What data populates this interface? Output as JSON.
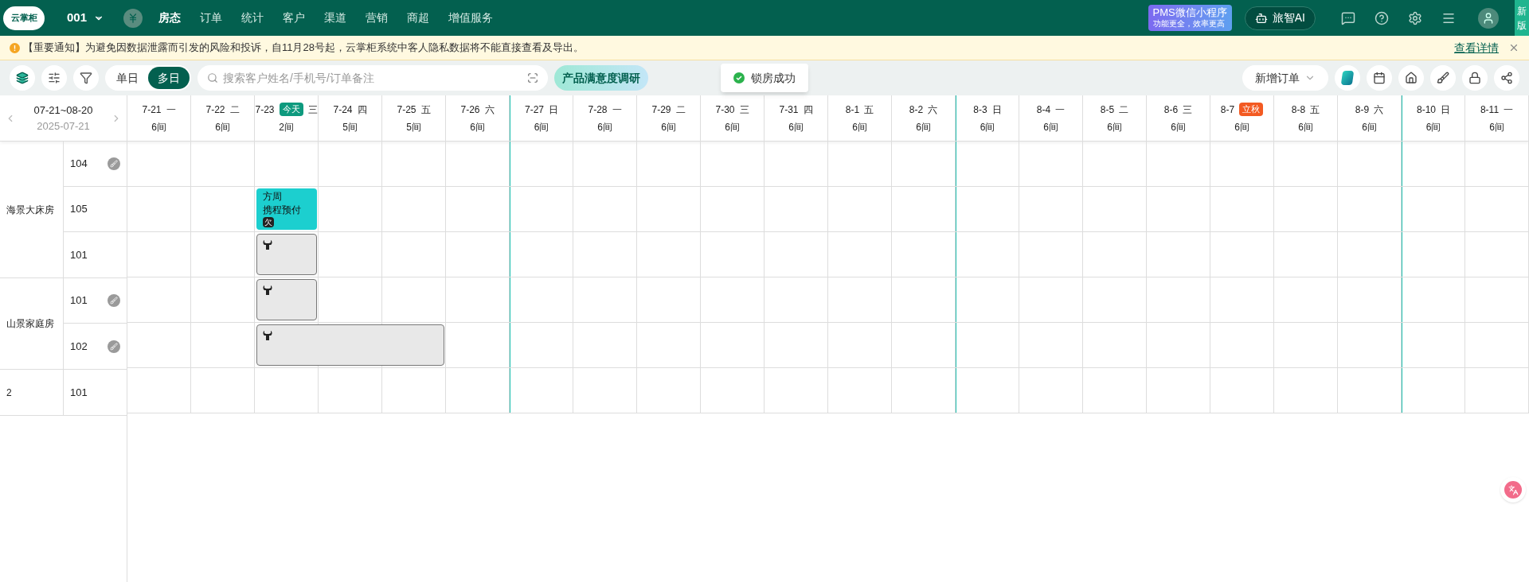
{
  "topbar": {
    "logo": "云掌柜",
    "store": "001",
    "nav": [
      {
        "label": "房态",
        "selected": true
      },
      {
        "label": "订单",
        "selected": false
      },
      {
        "label": "统计",
        "selected": false
      },
      {
        "label": "客户",
        "selected": false
      },
      {
        "label": "渠道",
        "selected": false
      },
      {
        "label": "营销",
        "selected": false
      },
      {
        "label": "商超",
        "selected": false
      },
      {
        "label": "增值服务",
        "selected": false
      }
    ],
    "promo": {
      "title": "PMS微信小程序",
      "subtitle": "功能更全，效率更高"
    },
    "ai_button": "旅智AI",
    "new_tab": "新版"
  },
  "notice": {
    "text": "【重要通知】为避免因数据泄露而引发的风险和投诉，自11月28号起，云掌柜系统中客人隐私数据将不能直接查看及导出。",
    "link": "查看详情"
  },
  "toolbar": {
    "modes": [
      {
        "label": "单日",
        "selected": false
      },
      {
        "label": "多日",
        "selected": true
      }
    ],
    "search": {
      "placeholder": "搜索客户姓名/手机号/订单备注"
    },
    "survey": "产品满意度调研",
    "new_order": "新增订单"
  },
  "toast": "锁房成功",
  "range": {
    "label": "07-21~08-20",
    "date": "2025-07-21"
  },
  "days": [
    {
      "date": "7-21",
      "weekday": "一",
      "count": "6间",
      "week_start": false
    },
    {
      "date": "7-22",
      "weekday": "二",
      "count": "6间",
      "week_start": false
    },
    {
      "date": "7-23",
      "weekday": "三",
      "count": "2间",
      "badge": {
        "kind": "today",
        "text": "今天"
      },
      "week_start": false
    },
    {
      "date": "7-24",
      "weekday": "四",
      "count": "5间",
      "week_start": false
    },
    {
      "date": "7-25",
      "weekday": "五",
      "count": "5间",
      "week_start": false
    },
    {
      "date": "7-26",
      "weekday": "六",
      "count": "6间",
      "week_start": false
    },
    {
      "date": "7-27",
      "weekday": "日",
      "count": "6间",
      "week_start": true
    },
    {
      "date": "7-28",
      "weekday": "一",
      "count": "6间",
      "week_start": false
    },
    {
      "date": "7-29",
      "weekday": "二",
      "count": "6间",
      "week_start": false
    },
    {
      "date": "7-30",
      "weekday": "三",
      "count": "6间",
      "week_start": false
    },
    {
      "date": "7-31",
      "weekday": "四",
      "count": "6间",
      "week_start": false
    },
    {
      "date": "8-1",
      "weekday": "五",
      "count": "6间",
      "week_start": false
    },
    {
      "date": "8-2",
      "weekday": "六",
      "count": "6间",
      "week_start": false
    },
    {
      "date": "8-3",
      "weekday": "日",
      "count": "6间",
      "week_start": true
    },
    {
      "date": "8-4",
      "weekday": "一",
      "count": "6间",
      "week_start": false
    },
    {
      "date": "8-5",
      "weekday": "二",
      "count": "6间",
      "week_start": false
    },
    {
      "date": "8-6",
      "weekday": "三",
      "count": "6间",
      "week_start": false
    },
    {
      "date": "8-7",
      "count": "6间",
      "badge": {
        "kind": "holiday",
        "text": "立秋"
      },
      "week_start": false
    },
    {
      "date": "8-8",
      "weekday": "五",
      "count": "6间",
      "week_start": false
    },
    {
      "date": "8-9",
      "weekday": "六",
      "count": "6间",
      "week_start": false
    },
    {
      "date": "8-10",
      "weekday": "日",
      "count": "6间",
      "week_start": true
    },
    {
      "date": "8-11",
      "weekday": "一",
      "count": "6间",
      "week_start": false
    }
  ],
  "room_types": [
    {
      "name": "海景大床房",
      "rooms": [
        {
          "number": "104",
          "dirty": true,
          "cells": [
            {
              "kind": "free"
            },
            {
              "kind": "free"
            },
            {
              "kind": "free"
            },
            {
              "kind": "free"
            },
            {
              "kind": "free"
            },
            {
              "kind": "free"
            },
            {
              "kind": "free"
            },
            {
              "kind": "free"
            },
            {
              "kind": "free"
            },
            {
              "kind": "free"
            },
            {
              "kind": "free"
            },
            {
              "kind": "free"
            },
            {
              "kind": "free"
            },
            {
              "kind": "free"
            },
            {
              "kind": "free"
            },
            {
              "kind": "free"
            },
            {
              "kind": "free"
            },
            {
              "kind": "free"
            },
            {
              "kind": "free"
            },
            {
              "kind": "free"
            },
            {
              "kind": "free"
            },
            {
              "kind": "free"
            }
          ]
        },
        {
          "number": "105",
          "dirty": false,
          "cells": [
            {
              "kind": "free"
            },
            {
              "kind": "free"
            },
            {
              "kind": "booking",
              "guest": "方周",
              "source": "携程预付",
              "tag": "欠"
            },
            {
              "kind": "free"
            },
            {
              "kind": "free"
            },
            {
              "kind": "free"
            },
            {
              "kind": "free"
            },
            {
              "kind": "free"
            },
            {
              "kind": "free"
            },
            {
              "kind": "free"
            },
            {
              "kind": "free"
            },
            {
              "kind": "free"
            },
            {
              "kind": "free"
            },
            {
              "kind": "free"
            },
            {
              "kind": "free"
            },
            {
              "kind": "free"
            },
            {
              "kind": "free"
            },
            {
              "kind": "free"
            },
            {
              "kind": "free"
            },
            {
              "kind": "free"
            },
            {
              "kind": "free"
            },
            {
              "kind": "free"
            }
          ]
        },
        {
          "number": "101",
          "dirty": false,
          "cells": [
            {
              "kind": "free"
            },
            {
              "kind": "free"
            },
            {
              "kind": "locked"
            },
            {
              "kind": "free"
            },
            {
              "kind": "free"
            },
            {
              "kind": "free"
            },
            {
              "kind": "free"
            },
            {
              "kind": "free"
            },
            {
              "kind": "free"
            },
            {
              "kind": "free"
            },
            {
              "kind": "free"
            },
            {
              "kind": "free"
            },
            {
              "kind": "free"
            },
            {
              "kind": "free"
            },
            {
              "kind": "free"
            },
            {
              "kind": "free"
            },
            {
              "kind": "free"
            },
            {
              "kind": "free"
            },
            {
              "kind": "free"
            },
            {
              "kind": "free"
            },
            {
              "kind": "free"
            },
            {
              "kind": "free"
            }
          ]
        }
      ]
    },
    {
      "name": "山景家庭房",
      "rooms": [
        {
          "number": "101",
          "dirty": true,
          "cells": [
            {
              "kind": "free"
            },
            {
              "kind": "free"
            },
            {
              "kind": "locked"
            },
            {
              "kind": "free"
            },
            {
              "kind": "free"
            },
            {
              "kind": "free"
            },
            {
              "kind": "free"
            },
            {
              "kind": "free"
            },
            {
              "kind": "free"
            },
            {
              "kind": "free"
            },
            {
              "kind": "free"
            },
            {
              "kind": "free"
            },
            {
              "kind": "free"
            },
            {
              "kind": "free"
            },
            {
              "kind": "free"
            },
            {
              "kind": "free"
            },
            {
              "kind": "free"
            },
            {
              "kind": "free"
            },
            {
              "kind": "free"
            },
            {
              "kind": "free"
            },
            {
              "kind": "free"
            },
            {
              "kind": "free"
            }
          ]
        },
        {
          "number": "102",
          "dirty": true,
          "cells": [
            {
              "kind": "free"
            },
            {
              "kind": "free"
            },
            {
              "kind": "locked"
            },
            {
              "kind": "locked_cont"
            },
            {
              "kind": "locked_cont"
            },
            {
              "kind": "free"
            },
            {
              "kind": "free"
            },
            {
              "kind": "free"
            },
            {
              "kind": "free"
            },
            {
              "kind": "free"
            },
            {
              "kind": "free"
            },
            {
              "kind": "free"
            },
            {
              "kind": "free"
            },
            {
              "kind": "free"
            },
            {
              "kind": "free"
            },
            {
              "kind": "free"
            },
            {
              "kind": "free"
            },
            {
              "kind": "free"
            },
            {
              "kind": "free"
            },
            {
              "kind": "free"
            },
            {
              "kind": "free"
            },
            {
              "kind": "free"
            }
          ]
        }
      ]
    },
    {
      "name": "2",
      "rooms": [
        {
          "number": "101",
          "dirty": false,
          "cells": [
            {
              "kind": "free"
            },
            {
              "kind": "free"
            },
            {
              "kind": "free"
            },
            {
              "kind": "free"
            },
            {
              "kind": "free"
            },
            {
              "kind": "free"
            },
            {
              "kind": "free"
            },
            {
              "kind": "free"
            },
            {
              "kind": "free"
            },
            {
              "kind": "free"
            },
            {
              "kind": "free"
            },
            {
              "kind": "free"
            },
            {
              "kind": "free"
            },
            {
              "kind": "free"
            },
            {
              "kind": "free"
            },
            {
              "kind": "free"
            },
            {
              "kind": "free"
            },
            {
              "kind": "free"
            },
            {
              "kind": "free"
            },
            {
              "kind": "free"
            },
            {
              "kind": "free"
            },
            {
              "kind": "free"
            }
          ]
        }
      ]
    }
  ]
}
